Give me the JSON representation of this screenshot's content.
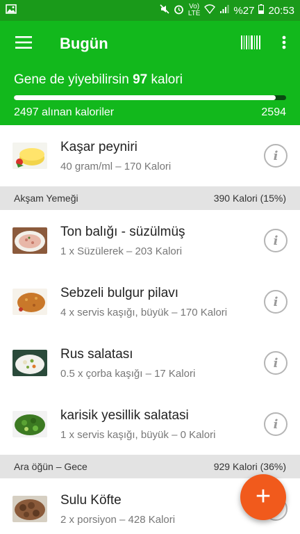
{
  "status_bar": {
    "battery": "%27",
    "time": "20:53",
    "volte": "Vo)",
    "lte": "LTE"
  },
  "app_bar": {
    "title": "Bugün"
  },
  "summary": {
    "remaining_prefix": "Gene de yiyebilirsin",
    "remaining_value": "97",
    "remaining_suffix": "kalori",
    "consumed_label": "2497 alınan kaloriler",
    "goal": "2594",
    "progress_fraction": 0.963
  },
  "items_top": [
    {
      "name": "Kaşar peyniri",
      "desc": "40 gram/ml – 170 Kalori",
      "thumb": "cheese"
    }
  ],
  "sections": [
    {
      "name": "Akşam Yemeği",
      "calories": "390 Kalori (15%)",
      "items": [
        {
          "name": "Ton balığı - süzülmüş",
          "desc": "1 x Süzülerek – 203 Kalori",
          "thumb": "tuna"
        },
        {
          "name": "Sebzeli bulgur pilavı",
          "desc": "4 x servis kaşığı, büyük – 170 Kalori",
          "thumb": "bulgur"
        },
        {
          "name": "Rus salatası",
          "desc": "0.5 x çorba kaşığı – 17 Kalori",
          "thumb": "salad"
        },
        {
          "name": "karisik yesillik salatasi",
          "desc": "1 x servis kaşığı, büyük – 0 Kalori",
          "thumb": "greens"
        }
      ]
    },
    {
      "name": "Ara öğün – Gece",
      "calories": "929 Kalori (36%)",
      "items": [
        {
          "name": "Sulu Köfte",
          "desc": "2 x porsiyon – 428 Kalori",
          "thumb": "kofte"
        }
      ]
    }
  ],
  "info_icon_glyph": "i",
  "fab_glyph": "+",
  "colors": {
    "status_bar": "#1a9a1a",
    "app_bar": "#12b81c",
    "fab": "#f15a1c",
    "section_bg": "#e3e3e3"
  }
}
